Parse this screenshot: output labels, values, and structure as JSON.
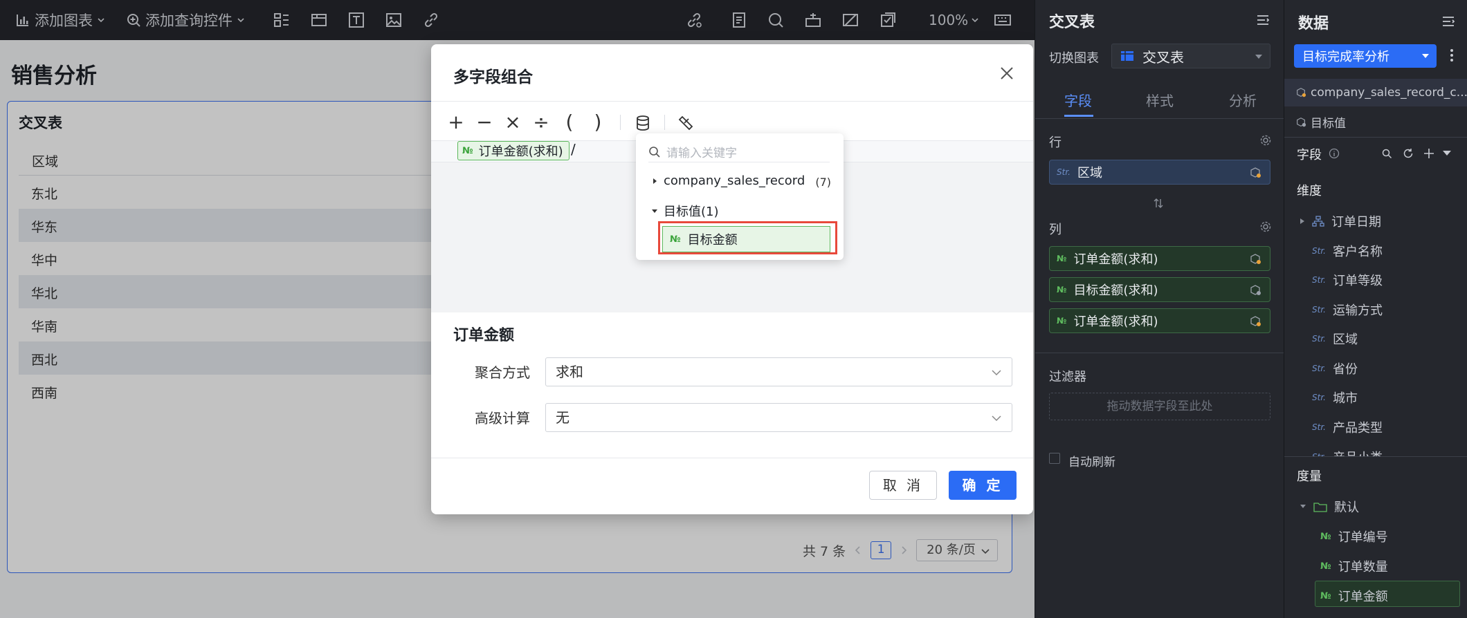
{
  "toolbar": {
    "add_chart": "添加图表",
    "add_query_control": "添加查询控件",
    "zoom": "100%"
  },
  "canvas": {
    "page_title": "销售分析",
    "card_title": "交叉表",
    "column_header": "区域",
    "rows": [
      "东北",
      "华东",
      "华中",
      "华北",
      "华南",
      "西北",
      "西南"
    ],
    "pager": {
      "total": "共 7 条",
      "current_page": "1",
      "page_size": "20 条/页"
    }
  },
  "dialog": {
    "title": "多字段组合",
    "operators": [
      "+",
      "−",
      "×",
      "÷",
      "(",
      ")"
    ],
    "expression": {
      "chip_label": "订单金额(求和)",
      "trailing_operator": "/"
    },
    "field_picker": {
      "search_placeholder": "请输入关键字",
      "datasets": [
        {
          "name": "company_sales_record",
          "count": "(7)",
          "expanded": false
        },
        {
          "name": "目标值(1)",
          "count": "",
          "expanded": true
        }
      ],
      "leaf_item": "目标金额"
    },
    "field_section_title": "订单金额",
    "aggregation_label": "聚合方式",
    "aggregation_value": "求和",
    "advanced_label": "高级计算",
    "advanced_value": "无",
    "cancel_label": "取 消",
    "ok_label": "确 定"
  },
  "config_panel": {
    "title": "交叉表",
    "switch_chart_label": "切换图表",
    "switch_chart_value": "交叉表",
    "tabs": [
      "字段",
      "样式",
      "分析"
    ],
    "active_tab": "字段",
    "rows_label": "行",
    "row_fields": [
      "区域"
    ],
    "cols_label": "列",
    "col_fields": [
      "订单金额(求和)",
      "目标金额(求和)",
      "订单金额(求和)"
    ],
    "filter_label": "过滤器",
    "filter_placeholder": "拖动数据字段至此处",
    "auto_refresh_label": "自动刷新"
  },
  "data_panel": {
    "title": "数据",
    "dataset_button": "目标完成率分析",
    "datasets": [
      "company_sales_record_c...",
      "目标值"
    ],
    "fields_label": "字段",
    "dimensions_label": "维度",
    "dimensions": [
      "订单日期",
      "客户名称",
      "订单等级",
      "运输方式",
      "区域",
      "省份",
      "城市",
      "产品类型",
      "产品小类"
    ],
    "measures_label": "度量",
    "measure_group": "默认",
    "measures": [
      "订单编号",
      "订单数量",
      "订单金额"
    ]
  },
  "colors": {
    "accent": "#2b6cf5",
    "highlight_box": "#e8493b",
    "numeric_field": "#5cb85c",
    "dark_panel": "#25272d"
  }
}
